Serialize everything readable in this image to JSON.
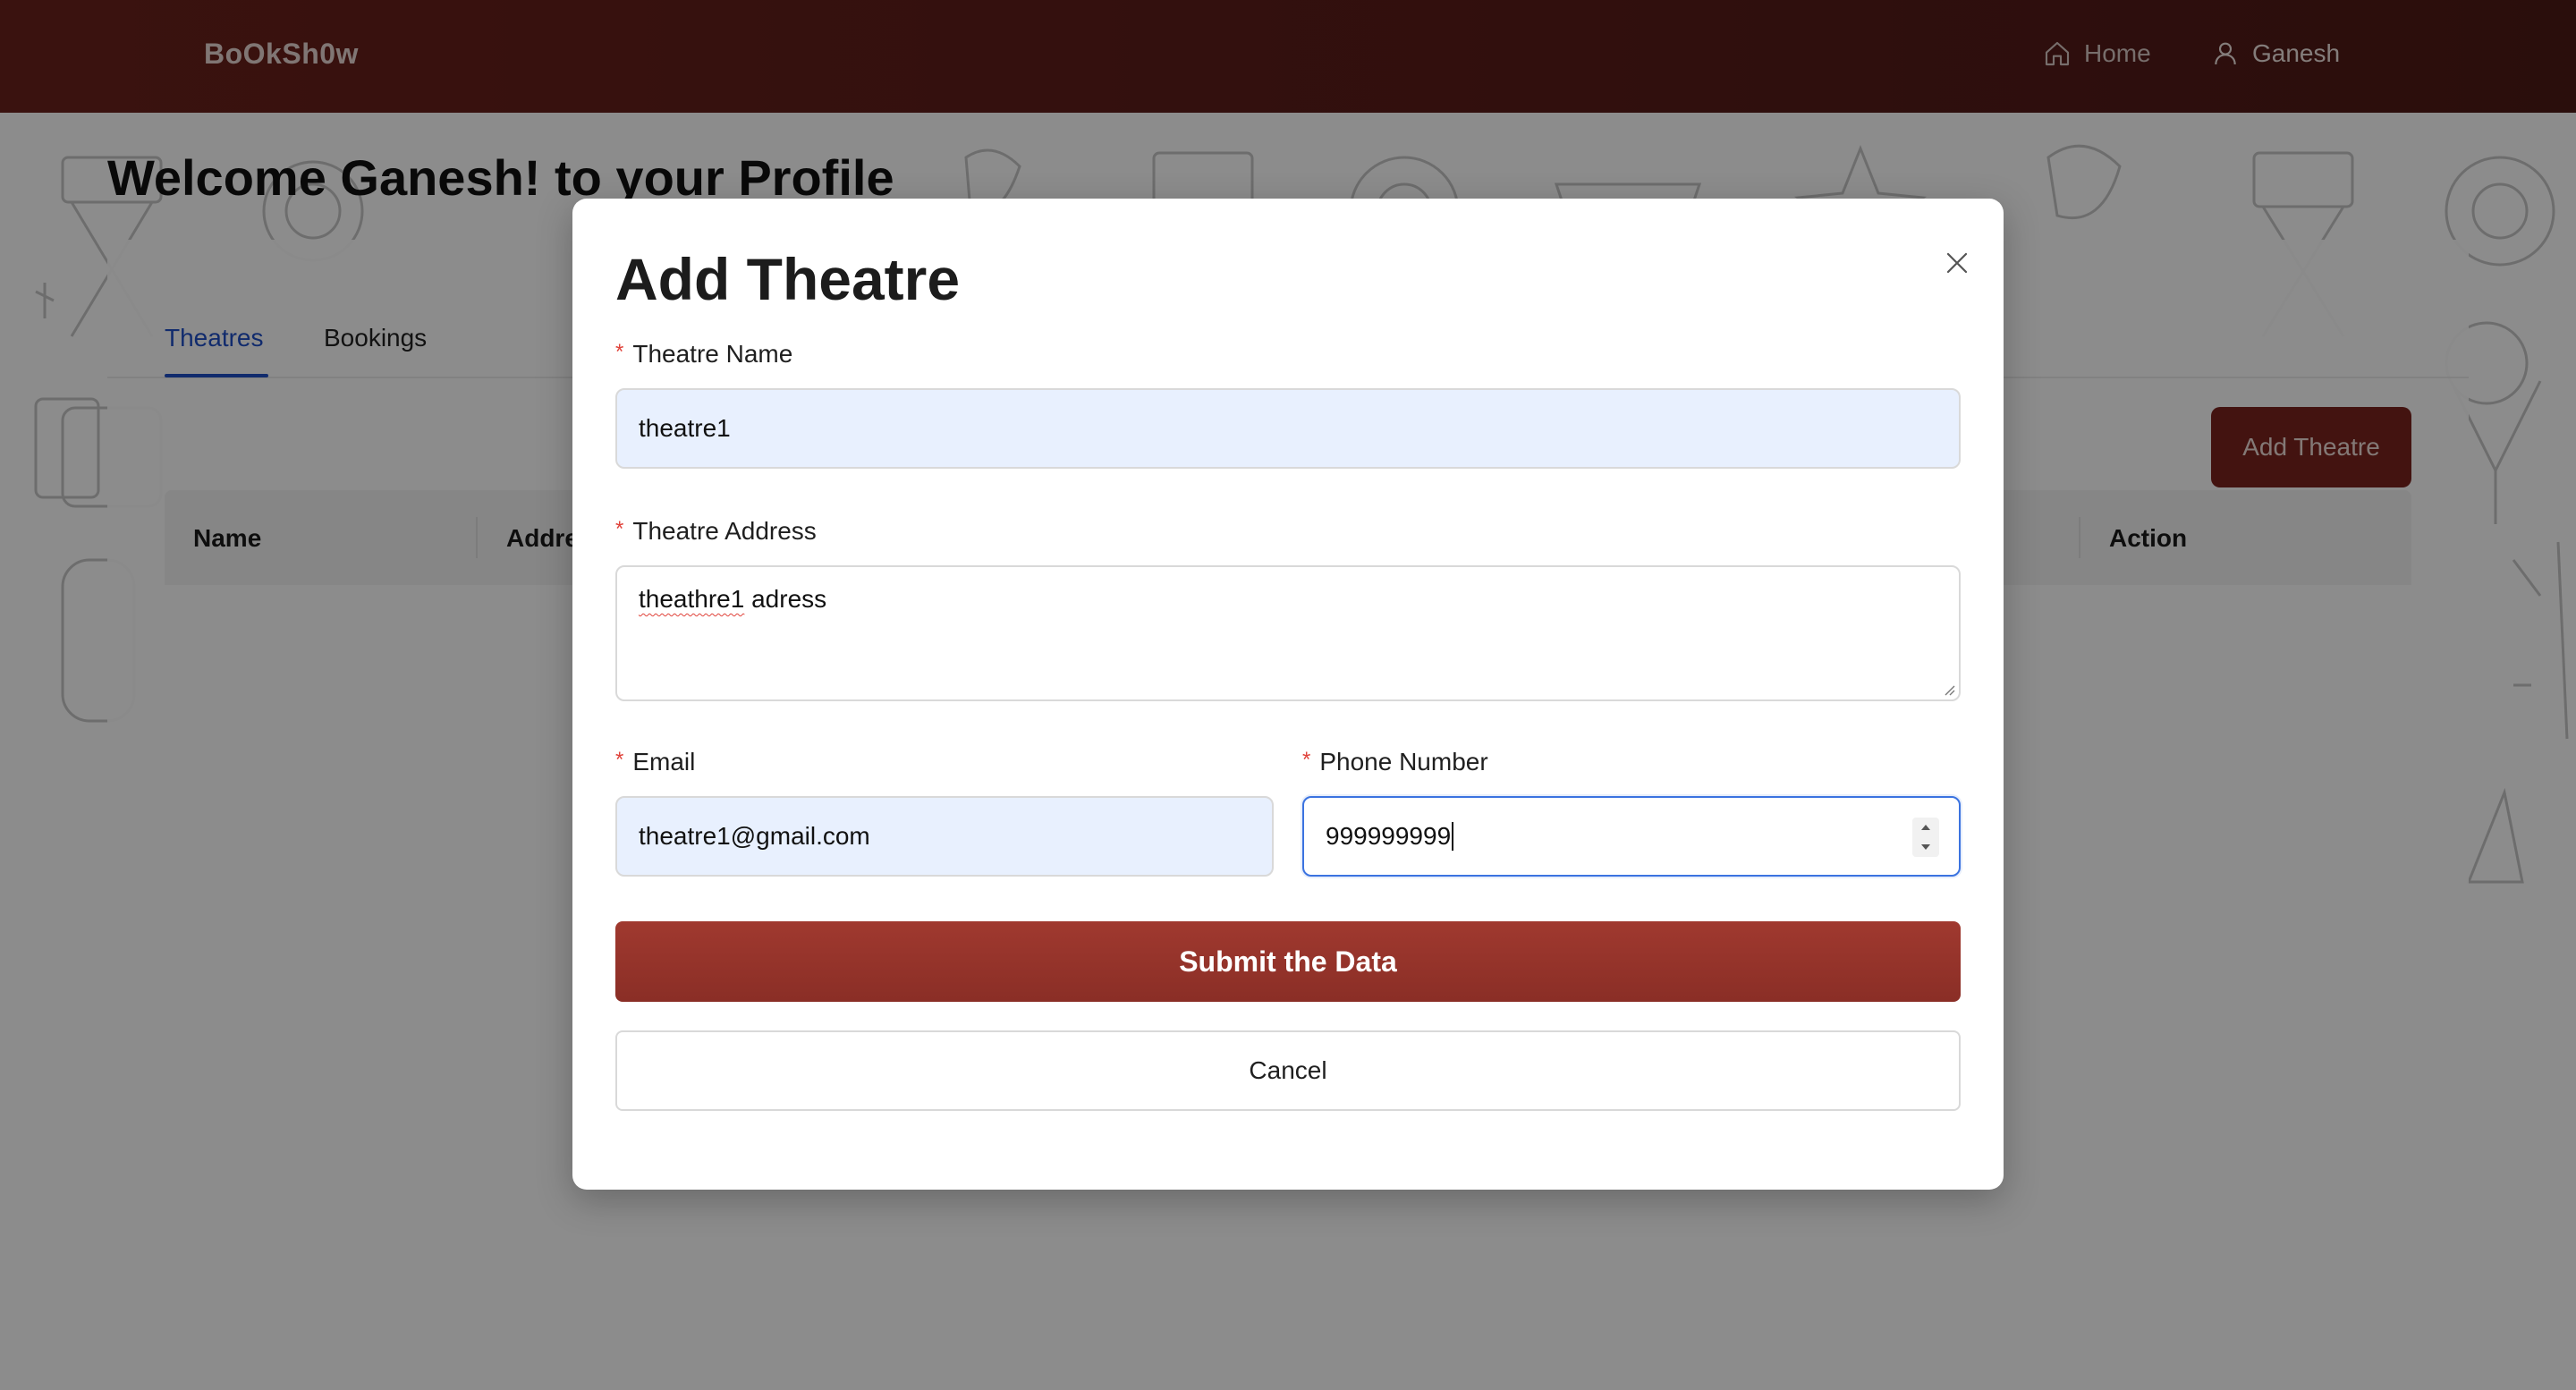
{
  "navbar": {
    "brand": "BoOkSh0w",
    "home_label": "Home",
    "user_label": "Ganesh"
  },
  "page": {
    "welcome": "Welcome Ganesh! to your Profile",
    "tabs": [
      {
        "label": "Theatres",
        "active": true
      },
      {
        "label": "Bookings",
        "active": false
      }
    ],
    "add_button_label": "Add Theatre",
    "table_headers": {
      "name": "Name",
      "address": "Addre",
      "action": "Action"
    }
  },
  "modal": {
    "title": "Add Theatre",
    "fields": {
      "theatre_name": {
        "label": "Theatre Name",
        "value": "theatre1"
      },
      "theatre_address": {
        "label": "Theatre Address",
        "value_misspelled": "theathre1",
        "value_rest": " adress"
      },
      "email": {
        "label": "Email",
        "value": "theatre1@gmail.com"
      },
      "phone": {
        "label": "Phone Number",
        "value": "999999999"
      }
    },
    "submit_label": "Submit the Data",
    "cancel_label": "Cancel"
  },
  "colors": {
    "navbar": "#5c1d19",
    "primary_button": "#962f26",
    "active_tab": "#1f4fc7",
    "focus_border": "#3b73e0",
    "required_marker": "#e0423a",
    "autofill_bg": "#e8f0fe"
  }
}
